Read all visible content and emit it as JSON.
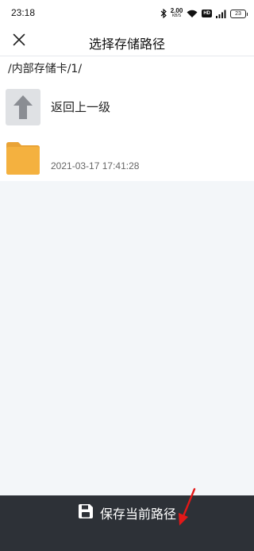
{
  "status_bar": {
    "time": "23:18",
    "net_speed_value": "2.00",
    "net_speed_unit": "KB/S",
    "hd_badge": "HD",
    "battery": "23"
  },
  "header": {
    "title": "选择存储路径",
    "close_icon": "close-icon"
  },
  "breadcrumb": {
    "path": "/内部存储卡/1/"
  },
  "file_list": [
    {
      "type": "parent",
      "icon": "up-arrow-icon",
      "label": "返回上一级"
    },
    {
      "type": "folder",
      "icon": "folder-icon",
      "label": "",
      "modified": "2021-03-17 17:41:28"
    }
  ],
  "bottom_bar": {
    "save_label": "保存当前路径",
    "save_icon": "floppy-disk-icon"
  },
  "annotation": {
    "arrow_icon": "red-arrow-icon",
    "color": "#e31818"
  },
  "colors": {
    "folder": "#f4b13f",
    "bottom_bar": "#2d3137",
    "page_bg": "#f3f6f9"
  }
}
